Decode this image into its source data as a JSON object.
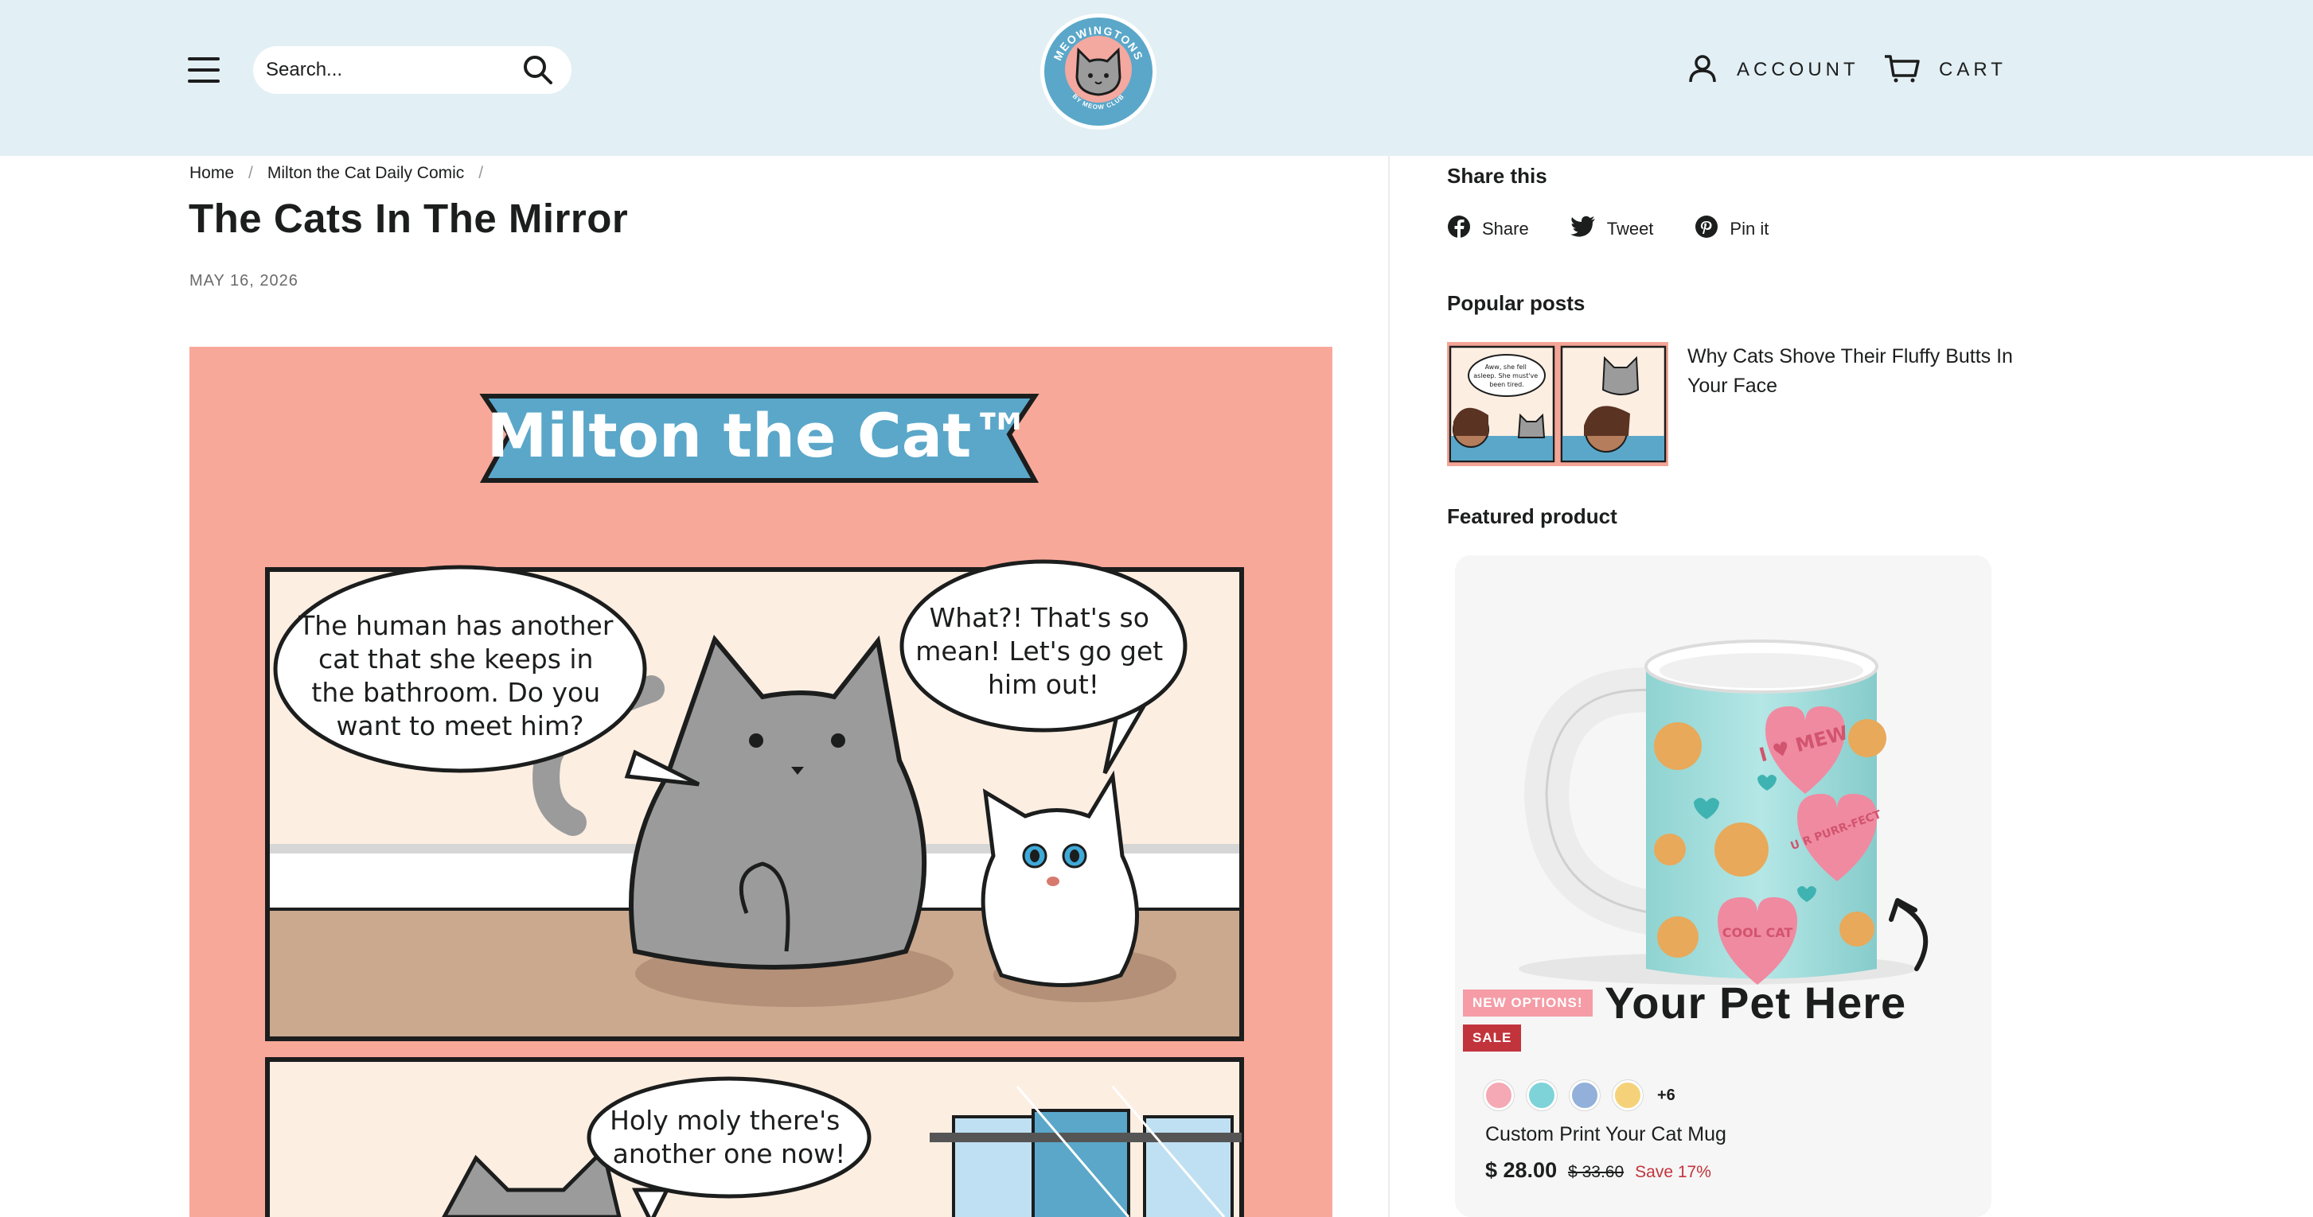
{
  "header": {
    "menu_icon": "hamburger-menu-icon",
    "search_placeholder": "Search...",
    "search_icon": "search-icon",
    "logo": {
      "brand_text": "MEOWINGTONS",
      "sub_text": "BY MEOW CLUB"
    },
    "account_label": "ACCOUNT",
    "cart_label": "CART"
  },
  "breadcrumb": {
    "items": [
      "Home",
      "Milton the Cat Daily Comic"
    ],
    "separator": "/"
  },
  "article": {
    "title": "The Cats In The Mirror",
    "date": "MAY 16, 2026",
    "comic": {
      "banner": "Milton the Cat™",
      "bubble_1": [
        "The human has another",
        "cat that she keeps in",
        "the bathroom. Do you",
        "want to meet him?"
      ],
      "bubble_2": [
        "What?! That's so",
        "mean! Let's go get",
        "him out!"
      ],
      "bubble_3": [
        "Holy moly there's",
        "another one now!"
      ]
    }
  },
  "sidebar": {
    "share_heading": "Share this",
    "share_items": [
      {
        "label": "Share",
        "icon": "facebook-icon"
      },
      {
        "label": "Tweet",
        "icon": "twitter-icon"
      },
      {
        "label": "Pin it",
        "icon": "pinterest-icon"
      }
    ],
    "popular_heading": "Popular posts",
    "popular_post": {
      "title": "Why Cats Shove Their Fluffy Butts In Your Face",
      "thumb_text": [
        "Aww, she fell",
        "asleep. She must've",
        "been tired."
      ]
    },
    "featured_heading": "Featured product",
    "product": {
      "badge_new": "NEW OPTIONS!",
      "badge_sale": "SALE",
      "image_caption": "Your Pet Here",
      "mug_hearts": [
        "I ♥ MEW",
        "U R PURR-FECT",
        "COOL CAT"
      ],
      "swatches": [
        "#f4a9b4",
        "#7ed3d8",
        "#92b0d9",
        "#f5d27a"
      ],
      "more_swatches": "+6",
      "title": "Custom Print Your Cat Mug",
      "price": "$ 28.00",
      "compare_price": "$ 33.60",
      "save_text": "Save 17%"
    }
  },
  "colors": {
    "header_bg": "#e2eff4",
    "comic_bg": "#f8a899",
    "banner_blue": "#5aa7c9",
    "sale_red": "#c2343c",
    "new_pink": "#f59ca6"
  }
}
